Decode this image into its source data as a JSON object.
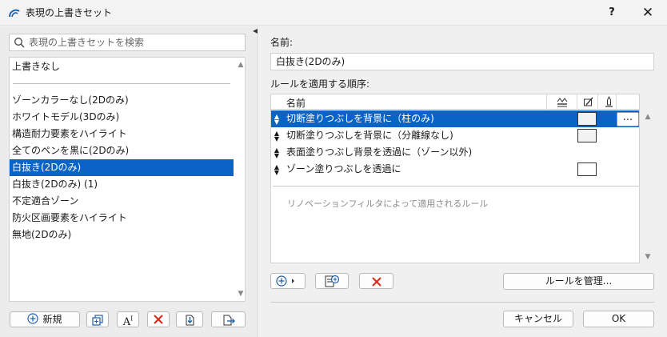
{
  "window": {
    "title": "表現の上書きセット",
    "help_label": "?",
    "close_label": "✕"
  },
  "search": {
    "placeholder": "表現の上書きセットを検索"
  },
  "sets": {
    "no_override": "上書きなし",
    "items": [
      {
        "label": "ゾーンカラーなし(2Dのみ)",
        "selected": false
      },
      {
        "label": "ホワイトモデル(3Dのみ)",
        "selected": false
      },
      {
        "label": "構造耐力要素をハイライト",
        "selected": false
      },
      {
        "label": "全てのペンを黒に(2Dのみ)",
        "selected": false
      },
      {
        "label": "白抜き(2Dのみ)",
        "selected": true
      },
      {
        "label": "白抜き(2Dのみ) (1)",
        "selected": false
      },
      {
        "label": "不定適合ゾーン",
        "selected": false
      },
      {
        "label": "防火区画要素をハイライト",
        "selected": false
      },
      {
        "label": "無地(2Dのみ)",
        "selected": false
      }
    ]
  },
  "left_toolbar": {
    "new_label": "新規"
  },
  "detail": {
    "name_label": "名前:",
    "name_value": "白抜き(2Dのみ)",
    "order_label": "ルールを適用する順序:",
    "column_name": "名前",
    "rules": [
      {
        "label": "切断塗りつぶしを背景に（柱のみ)",
        "selected": true,
        "swatch": "gray",
        "more": true
      },
      {
        "label": "切断塗りつぶしを背景に（分離線なし)",
        "selected": false,
        "swatch": "gray",
        "more": false
      },
      {
        "label": "表面塗りつぶし背景を透過に（ゾーン以外)",
        "selected": false,
        "swatch": "none",
        "more": false
      },
      {
        "label": "ゾーン塗りつぶしを透過に",
        "selected": false,
        "swatch": "white",
        "more": false
      }
    ],
    "more_label": "...",
    "renovation_note": "リノベーションフィルタによって適用されるルール",
    "manage_label": "ルールを管理...",
    "cancel_label": "キャンセル",
    "ok_label": "OK"
  },
  "colors": {
    "selection": "#0a64c8",
    "delete_red": "#d42a1a",
    "icon_blue": "#1f5fae"
  }
}
